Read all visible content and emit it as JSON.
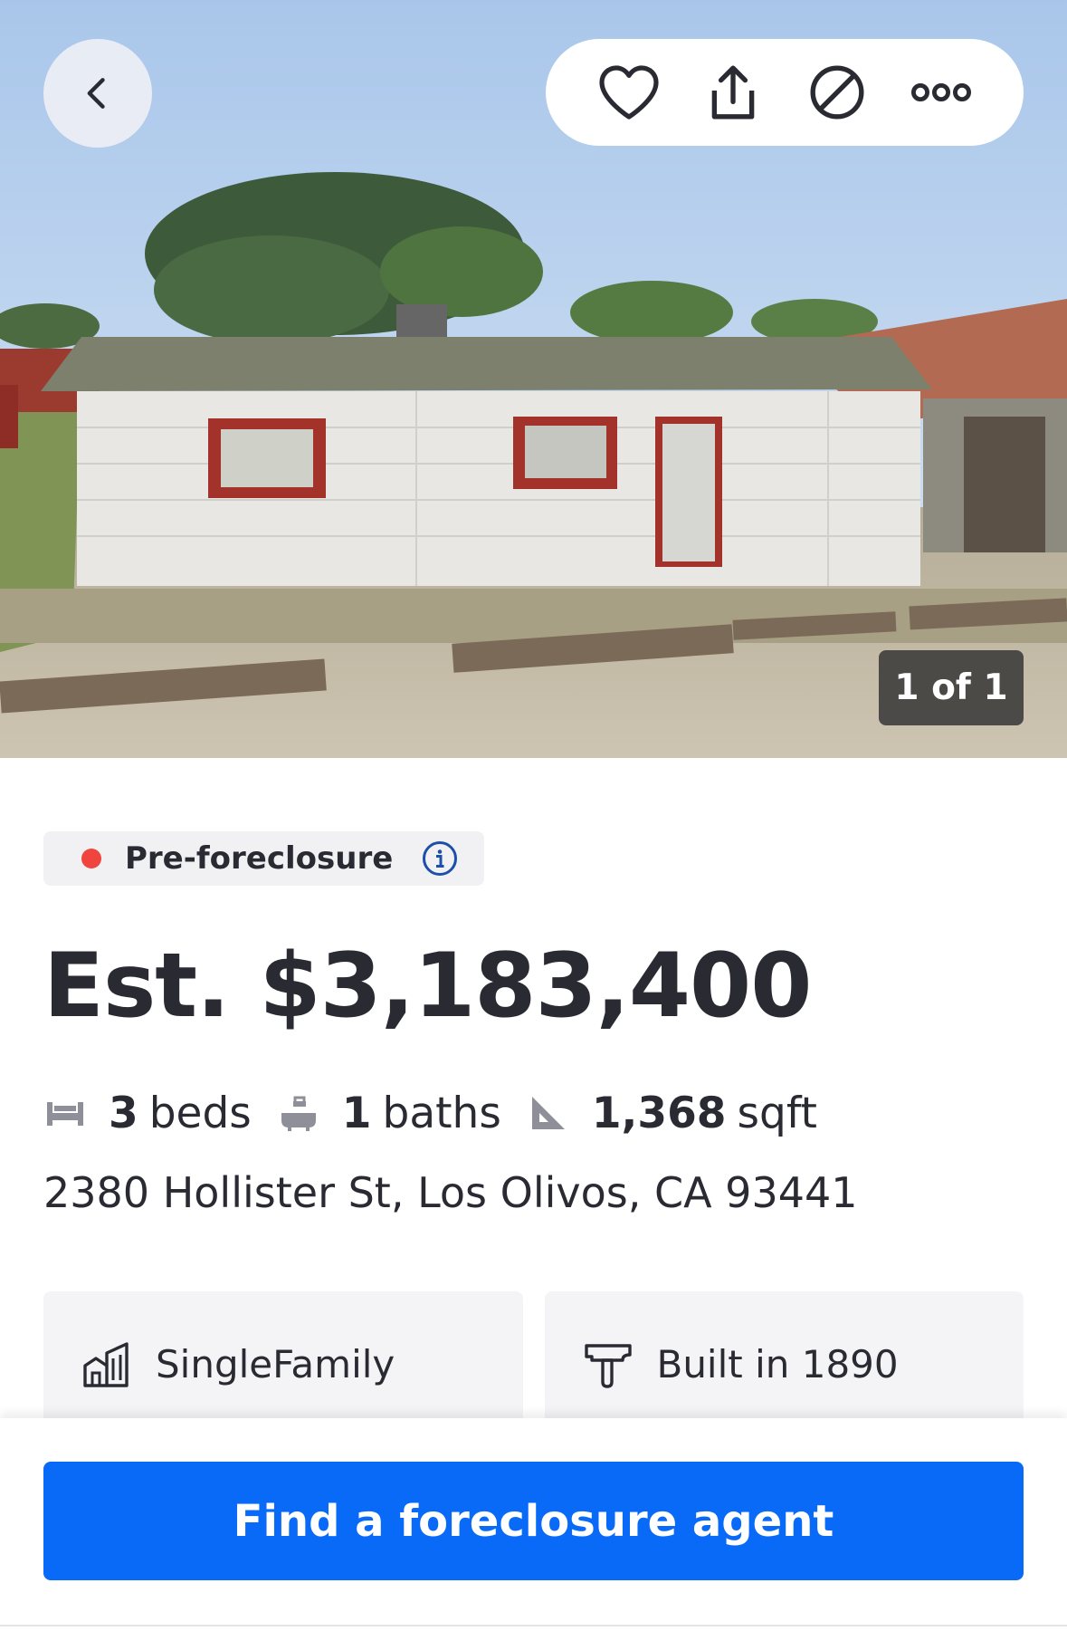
{
  "photo": {
    "counter_text": "1 of 1",
    "alt": "house photo"
  },
  "nav": {
    "back_icon": "chevron-left-icon",
    "actions": [
      {
        "name": "save",
        "icon": "heart-icon"
      },
      {
        "name": "share",
        "icon": "share-icon"
      },
      {
        "name": "hide",
        "icon": "block-icon"
      },
      {
        "name": "more",
        "icon": "more-icon"
      }
    ]
  },
  "listing": {
    "status": "Pre-foreclosure",
    "status_color": "#f0443f",
    "price": "Est. $3,183,400",
    "beds_value": "3",
    "beds_label": "beds",
    "baths_value": "1",
    "baths_label": "baths",
    "sqft_value": "1,368",
    "sqft_label": "sqft",
    "address": "2380 Hollister St, Los Olivos, CA 93441"
  },
  "facts_cards": [
    {
      "icon": "building-icon",
      "text": "SingleFamily"
    },
    {
      "icon": "hammer-icon",
      "text": "Built in 1890"
    }
  ],
  "cta": {
    "label": "Find a foreclosure agent",
    "color": "#0a6af8"
  }
}
